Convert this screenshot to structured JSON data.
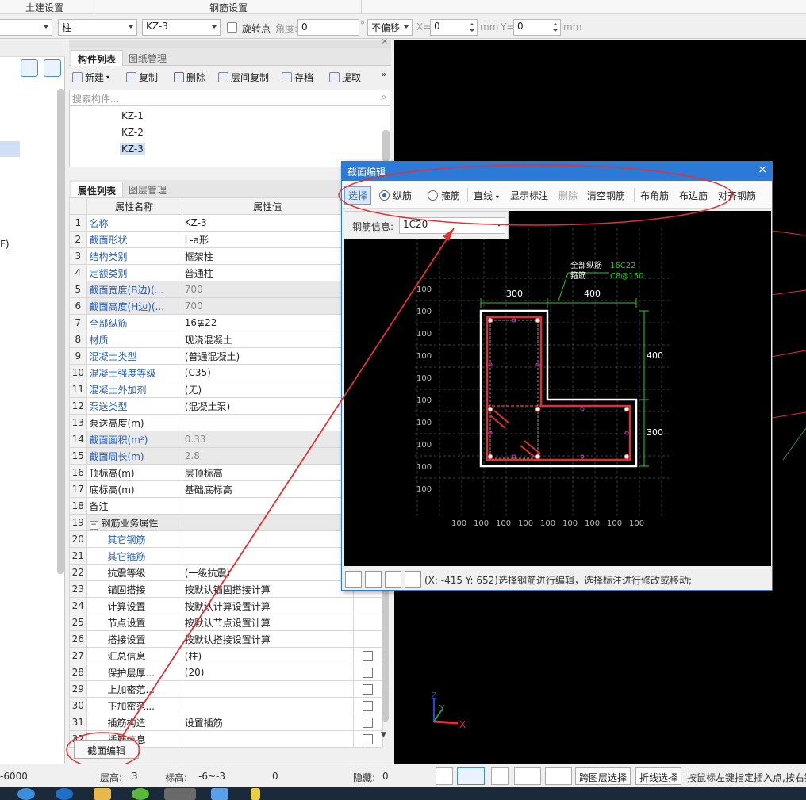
{
  "ribbon": {
    "tab1": "土建设置",
    "tab2": "钢筋设置"
  },
  "toolbar": {
    "combo1": "",
    "combo2": "柱",
    "combo3": "KZ-3",
    "rotate_label": "旋转点",
    "angle_label": "角度:",
    "angle_value": "0",
    "degree": "°",
    "offset_value": "不偏移",
    "x_label": "X=",
    "x_value": "0",
    "mm1": "mm",
    "y_label": "Y=",
    "y_value": "0",
    "mm2": "mm"
  },
  "left": {
    "text": "F)"
  },
  "component_panel": {
    "tab_active": "构件列表",
    "tab_inactive": "图纸管理",
    "btn_new": "新建",
    "btn_copy": "复制",
    "btn_delete": "删除",
    "btn_floor_copy": "层间复制",
    "btn_save": "存档",
    "btn_extract": "提取",
    "search_placeholder": "搜索构件...",
    "items": [
      "KZ-1",
      "KZ-2",
      "KZ-3"
    ]
  },
  "property_panel": {
    "tab_active": "属性列表",
    "tab_inactive": "图层管理",
    "col_name": "属性名称",
    "col_value": "属性值",
    "rows": [
      {
        "n": "1",
        "k": "名称",
        "v": "KZ-3",
        "blue": true
      },
      {
        "n": "2",
        "k": "截面形状",
        "v": "L-a形",
        "blue": true
      },
      {
        "n": "3",
        "k": "结构类别",
        "v": "框架柱",
        "blue": true
      },
      {
        "n": "4",
        "k": "定额类别",
        "v": "普通柱",
        "blue": true
      },
      {
        "n": "5",
        "k": "截面宽度(B边)(...",
        "v": "700",
        "blue": true,
        "gray": true
      },
      {
        "n": "6",
        "k": "截面高度(H边)(...",
        "v": "700",
        "blue": true,
        "gray": true
      },
      {
        "n": "7",
        "k": "全部纵筋",
        "v": "16⊈22",
        "blue": true
      },
      {
        "n": "8",
        "k": "材质",
        "v": "现浇混凝土",
        "blue": true
      },
      {
        "n": "9",
        "k": "混凝土类型",
        "v": "(普通混凝土)",
        "blue": true
      },
      {
        "n": "10",
        "k": "混凝土强度等级",
        "v": "(C35)",
        "blue": true
      },
      {
        "n": "11",
        "k": "混凝土外加剂",
        "v": "(无)",
        "blue": true
      },
      {
        "n": "12",
        "k": "泵送类型",
        "v": "(混凝土泵)",
        "blue": true
      },
      {
        "n": "13",
        "k": "泵送高度(m)",
        "v": "",
        "blue": false
      },
      {
        "n": "14",
        "k": "截面面积(m²)",
        "v": "0.33",
        "blue": true,
        "gray": true
      },
      {
        "n": "15",
        "k": "截面周长(m)",
        "v": "2.8",
        "blue": true,
        "gray": true
      },
      {
        "n": "16",
        "k": "顶标高(m)",
        "v": "层顶标高",
        "blue": false
      },
      {
        "n": "17",
        "k": "底标高(m)",
        "v": "基础底标高",
        "blue": false
      },
      {
        "n": "18",
        "k": "备注",
        "v": "",
        "blue": false
      },
      {
        "n": "19",
        "k": "钢筋业务属性",
        "v": "",
        "blue": false,
        "group": true,
        "gray": true
      },
      {
        "n": "20",
        "k": "其它钢筋",
        "v": "",
        "blue": true,
        "indent": true
      },
      {
        "n": "21",
        "k": "其它箍筋",
        "v": "",
        "blue": true,
        "indent": true
      },
      {
        "n": "22",
        "k": "抗震等级",
        "v": "(一级抗震)",
        "blue": false,
        "indent": true
      },
      {
        "n": "23",
        "k": "锚固搭接",
        "v": "按默认锚固搭接计算",
        "blue": false,
        "indent": true
      },
      {
        "n": "24",
        "k": "计算设置",
        "v": "按默认计算设置计算",
        "blue": false,
        "indent": true
      },
      {
        "n": "25",
        "k": "节点设置",
        "v": "按默认节点设置计算",
        "blue": false,
        "indent": true
      },
      {
        "n": "26",
        "k": "搭接设置",
        "v": "按默认搭接设置计算",
        "blue": false,
        "indent": true
      },
      {
        "n": "27",
        "k": "汇总信息",
        "v": "(柱)",
        "blue": false,
        "indent": true,
        "cb": true
      },
      {
        "n": "28",
        "k": "保护层厚...",
        "v": "(20)",
        "blue": false,
        "indent": true,
        "cb": true
      },
      {
        "n": "29",
        "k": "上加密范...",
        "v": "",
        "blue": false,
        "indent": true,
        "cb": true
      },
      {
        "n": "30",
        "k": "下加密范...",
        "v": "",
        "blue": false,
        "indent": true,
        "cb": true
      },
      {
        "n": "31",
        "k": "插筋构造",
        "v": "设置插筋",
        "blue": false,
        "indent": true,
        "cb": true
      },
      {
        "n": "32",
        "k": "插筋信息",
        "v": "",
        "blue": false,
        "indent": true,
        "cb": true
      }
    ],
    "edit_button": "截面编辑"
  },
  "dialog": {
    "title": "截面编辑",
    "close": "×",
    "btn_select": "选择",
    "radio_long": "纵筋",
    "radio_stirrup": "箍筋",
    "btn_line": "直线",
    "btn_show_dim": "显示标注",
    "btn_delete": "删除",
    "btn_clear": "清空钢筋",
    "btn_corner": "布角筋",
    "btn_edge": "布边筋",
    "btn_align": "对齐钢筋",
    "rebar_info_label": "钢筋信息:",
    "rebar_info_value": "1C20",
    "drawing": {
      "label_all_long": "全部纵筋",
      "label_stirrup": "箍筋",
      "val_all_long": "16C22",
      "val_stirrup": "C8@150",
      "dim_top1": "300",
      "dim_top2": "400",
      "dim_right1": "400",
      "dim_right2": "300",
      "grid_left": [
        "100",
        "100",
        "100",
        "100",
        "100",
        "100",
        "100",
        "100",
        "100",
        "100"
      ],
      "grid_bottom": [
        "100",
        "100",
        "100",
        "100",
        "100",
        "100",
        "100",
        "100",
        "100"
      ]
    },
    "status_text": "(X: -415 Y: 652)选择钢筋进行编辑，选择标注进行修改或移动;"
  },
  "canvas_axes": {
    "x": "X",
    "y": "Y",
    "z": "Z"
  },
  "statusbar": {
    "left": "-6000",
    "layer_h_label": "层高:",
    "layer_h": "3",
    "elev_label": "标高:",
    "elev": "-6~-3",
    "zero": "0",
    "hidden_label": "隐藏:",
    "hidden": "0",
    "btn_cross_layer": "跨图层选择",
    "btn_polyline": "折线选择",
    "hint": "按鼠标左键指定插入点,按右键"
  }
}
